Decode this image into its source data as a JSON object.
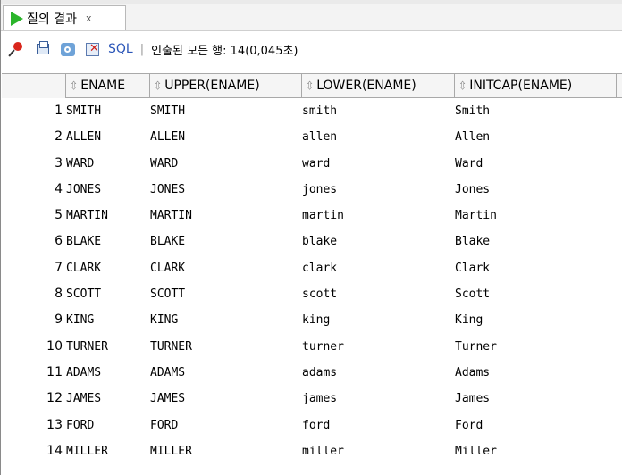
{
  "tab": {
    "label": "질의 결과",
    "close": "x"
  },
  "toolbar": {
    "sql_label": "SQL",
    "separator": "|",
    "status": "인출된 모든 행: 14(0,045초)"
  },
  "grid": {
    "columns": [
      "ENAME",
      "UPPER(ENAME)",
      "LOWER(ENAME)",
      "INITCAP(ENAME)"
    ],
    "rows": [
      {
        "n": "1",
        "c1": "SMITH",
        "c2": "SMITH",
        "c3": "smith",
        "c4": "Smith"
      },
      {
        "n": "2",
        "c1": "ALLEN",
        "c2": "ALLEN",
        "c3": "allen",
        "c4": "Allen"
      },
      {
        "n": "3",
        "c1": "WARD",
        "c2": "WARD",
        "c3": "ward",
        "c4": "Ward"
      },
      {
        "n": "4",
        "c1": "JONES",
        "c2": "JONES",
        "c3": "jones",
        "c4": "Jones"
      },
      {
        "n": "5",
        "c1": "MARTIN",
        "c2": "MARTIN",
        "c3": "martin",
        "c4": "Martin"
      },
      {
        "n": "6",
        "c1": "BLAKE",
        "c2": "BLAKE",
        "c3": "blake",
        "c4": "Blake"
      },
      {
        "n": "7",
        "c1": "CLARK",
        "c2": "CLARK",
        "c3": "clark",
        "c4": "Clark"
      },
      {
        "n": "8",
        "c1": "SCOTT",
        "c2": "SCOTT",
        "c3": "scott",
        "c4": "Scott"
      },
      {
        "n": "9",
        "c1": "KING",
        "c2": "KING",
        "c3": "king",
        "c4": "King"
      },
      {
        "n": "10",
        "c1": "TURNER",
        "c2": "TURNER",
        "c3": "turner",
        "c4": "Turner"
      },
      {
        "n": "11",
        "c1": "ADAMS",
        "c2": "ADAMS",
        "c3": "adams",
        "c4": "Adams"
      },
      {
        "n": "12",
        "c1": "JAMES",
        "c2": "JAMES",
        "c3": "james",
        "c4": "James"
      },
      {
        "n": "13",
        "c1": "FORD",
        "c2": "FORD",
        "c3": "ford",
        "c4": "Ford"
      },
      {
        "n": "14",
        "c1": "MILLER",
        "c2": "MILLER",
        "c3": "miller",
        "c4": "Miller"
      }
    ]
  }
}
